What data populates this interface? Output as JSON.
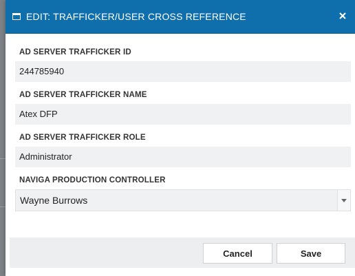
{
  "dialog": {
    "title": "EDIT: TRAFFICKER/USER CROSS REFERENCE",
    "icon": "window-icon",
    "close_icon": "close-icon"
  },
  "fields": {
    "trafficker_id": {
      "label": "AD SERVER TRAFFICKER ID",
      "value": "244785940"
    },
    "trafficker_name": {
      "label": "AD SERVER TRAFFICKER NAME",
      "value": "Atex DFP"
    },
    "trafficker_role": {
      "label": "AD SERVER TRAFFICKER ROLE",
      "value": "Administrator"
    },
    "production_controller": {
      "label": "NAVIGA PRODUCTION CONTROLLER",
      "selected": "Wayne Burrows"
    }
  },
  "footer": {
    "cancel_label": "Cancel",
    "save_label": "Save"
  },
  "colors": {
    "title_bar": "#0f6fad",
    "field_bg": "#f0f1f2",
    "footer_bg": "#eceeef"
  }
}
